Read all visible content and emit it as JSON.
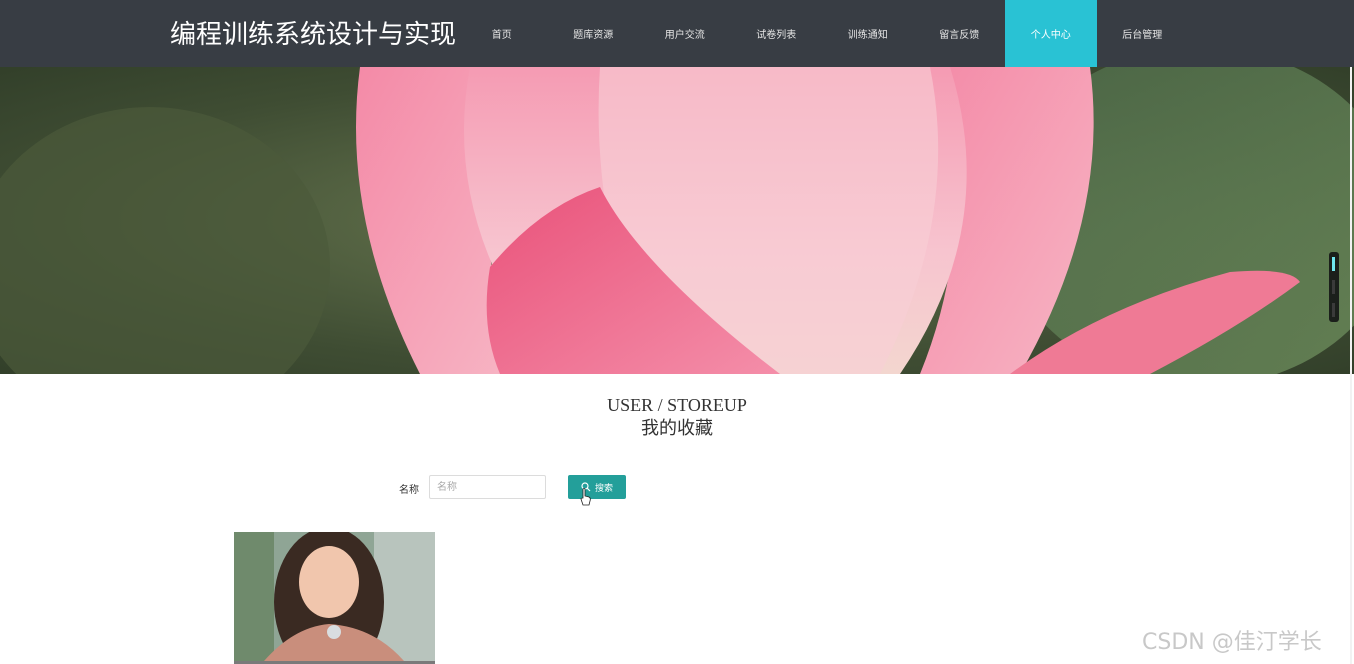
{
  "header": {
    "site_title": "编程训练系统设计与实现",
    "nav": [
      {
        "label": "首页",
        "active": false
      },
      {
        "label": "题库资源",
        "active": false
      },
      {
        "label": "用户交流",
        "active": false
      },
      {
        "label": "试卷列表",
        "active": false
      },
      {
        "label": "训练通知",
        "active": false
      },
      {
        "label": "留言反馈",
        "active": false
      },
      {
        "label": "个人中心",
        "active": true
      },
      {
        "label": "后台管理",
        "active": false
      }
    ]
  },
  "banner": {
    "image": "pink-lotus-flower",
    "slider_count": 3,
    "active_slide": 1
  },
  "section": {
    "title_en": "USER / STOREUP",
    "title_cn": "我的收藏"
  },
  "search": {
    "label": "名称",
    "placeholder": "名称",
    "value": "",
    "button_label": "搜索",
    "button_icon": "search-icon"
  },
  "favorites": [
    {
      "image": "woman-portrait-photo"
    }
  ],
  "watermark": "CSDN @佳汀学长",
  "colors": {
    "header_bg": "#383d44",
    "nav_active": "#29c2d4",
    "search_button": "#239f9a"
  }
}
